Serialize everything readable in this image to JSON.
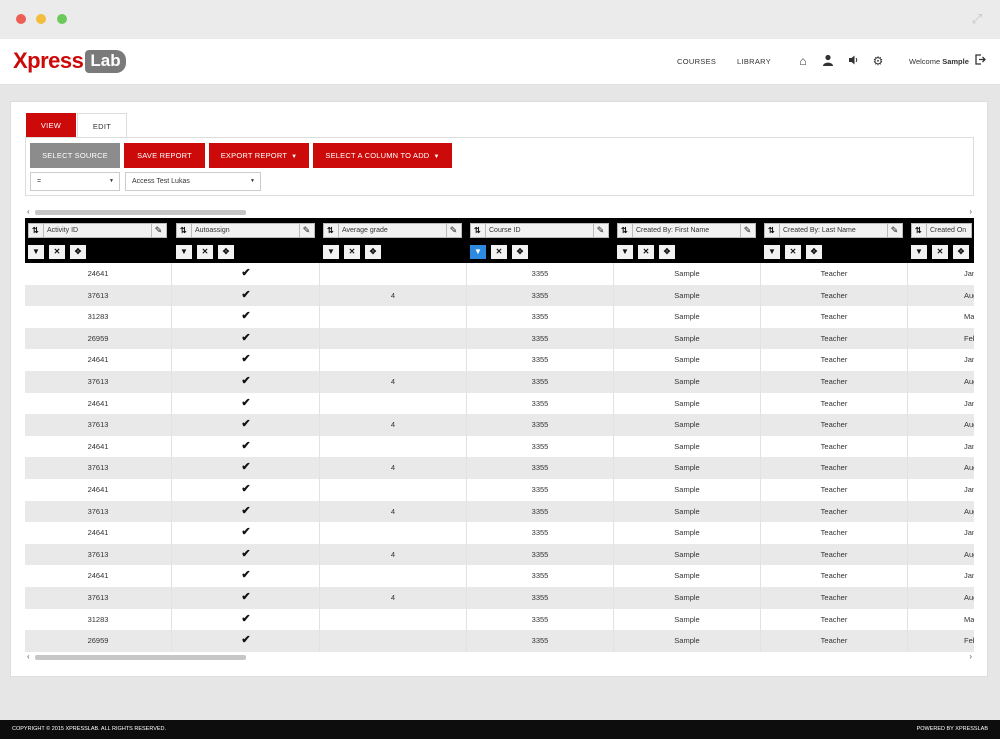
{
  "header": {
    "logo_text": "Xpress",
    "logo_badge": "Lab",
    "nav": {
      "courses": "COURSES",
      "library": "LIBRARY"
    },
    "icons": [
      "home-icon",
      "user-icon",
      "speaker-icon",
      "gear-icon"
    ],
    "welcome_prefix": "Welcome",
    "welcome_user": "Sample"
  },
  "tabs": {
    "view": "VIEW",
    "edit": "EDIT"
  },
  "toolbar": {
    "select_source": "SELECT SOURCE",
    "save_report": "SAVE REPORT",
    "export_report": "EXPORT REPORT",
    "select_column": "SELECT A COLUMN TO ADD"
  },
  "filters": {
    "operator": "=",
    "source": "Access Test Lukas"
  },
  "columns": [
    "Activity ID",
    "Autoassign",
    "Average grade",
    "Course ID",
    "Created By: First Name",
    "Created By: Last Name",
    "Created On"
  ],
  "rows": [
    {
      "activity_id": "24641",
      "autoassign": "✔",
      "average_grade": "",
      "course_id": "3355",
      "first_name": "Sample",
      "last_name": "Teacher",
      "created_on": "Jan"
    },
    {
      "activity_id": "37613",
      "autoassign": "✔",
      "average_grade": "4",
      "course_id": "3355",
      "first_name": "Sample",
      "last_name": "Teacher",
      "created_on": "Aug"
    },
    {
      "activity_id": "31283",
      "autoassign": "✔",
      "average_grade": "",
      "course_id": "3355",
      "first_name": "Sample",
      "last_name": "Teacher",
      "created_on": "Mar"
    },
    {
      "activity_id": "26959",
      "autoassign": "✔",
      "average_grade": "",
      "course_id": "3355",
      "first_name": "Sample",
      "last_name": "Teacher",
      "created_on": "Feb"
    },
    {
      "activity_id": "24641",
      "autoassign": "✔",
      "average_grade": "",
      "course_id": "3355",
      "first_name": "Sample",
      "last_name": "Teacher",
      "created_on": "Jan"
    },
    {
      "activity_id": "37613",
      "autoassign": "✔",
      "average_grade": "4",
      "course_id": "3355",
      "first_name": "Sample",
      "last_name": "Teacher",
      "created_on": "Aug"
    },
    {
      "activity_id": "24641",
      "autoassign": "✔",
      "average_grade": "",
      "course_id": "3355",
      "first_name": "Sample",
      "last_name": "Teacher",
      "created_on": "Jan"
    },
    {
      "activity_id": "37613",
      "autoassign": "✔",
      "average_grade": "4",
      "course_id": "3355",
      "first_name": "Sample",
      "last_name": "Teacher",
      "created_on": "Aug"
    },
    {
      "activity_id": "24641",
      "autoassign": "✔",
      "average_grade": "",
      "course_id": "3355",
      "first_name": "Sample",
      "last_name": "Teacher",
      "created_on": "Jan"
    },
    {
      "activity_id": "37613",
      "autoassign": "✔",
      "average_grade": "4",
      "course_id": "3355",
      "first_name": "Sample",
      "last_name": "Teacher",
      "created_on": "Aug"
    },
    {
      "activity_id": "24641",
      "autoassign": "✔",
      "average_grade": "",
      "course_id": "3355",
      "first_name": "Sample",
      "last_name": "Teacher",
      "created_on": "Jan"
    },
    {
      "activity_id": "37613",
      "autoassign": "✔",
      "average_grade": "4",
      "course_id": "3355",
      "first_name": "Sample",
      "last_name": "Teacher",
      "created_on": "Aug"
    },
    {
      "activity_id": "24641",
      "autoassign": "✔",
      "average_grade": "",
      "course_id": "3355",
      "first_name": "Sample",
      "last_name": "Teacher",
      "created_on": "Jan"
    },
    {
      "activity_id": "37613",
      "autoassign": "✔",
      "average_grade": "4",
      "course_id": "3355",
      "first_name": "Sample",
      "last_name": "Teacher",
      "created_on": "Aug"
    },
    {
      "activity_id": "24641",
      "autoassign": "✔",
      "average_grade": "",
      "course_id": "3355",
      "first_name": "Sample",
      "last_name": "Teacher",
      "created_on": "Jan"
    },
    {
      "activity_id": "37613",
      "autoassign": "✔",
      "average_grade": "4",
      "course_id": "3355",
      "first_name": "Sample",
      "last_name": "Teacher",
      "created_on": "Aug"
    },
    {
      "activity_id": "31283",
      "autoassign": "✔",
      "average_grade": "",
      "course_id": "3355",
      "first_name": "Sample",
      "last_name": "Teacher",
      "created_on": "Mar"
    },
    {
      "activity_id": "26959",
      "autoassign": "✔",
      "average_grade": "",
      "course_id": "3355",
      "first_name": "Sample",
      "last_name": "Teacher",
      "created_on": "Feb"
    }
  ],
  "footer": {
    "copyright": "COPYRIGHT © 2015 XPRESSLAB. ALL RIGHTS RESERVED.",
    "powered": "POWERED BY XPRESSLAB"
  },
  "colors": {
    "accent": "#cc0a0a",
    "secondary": "#8c8c8c",
    "active_filter": "#2c8ae0"
  }
}
